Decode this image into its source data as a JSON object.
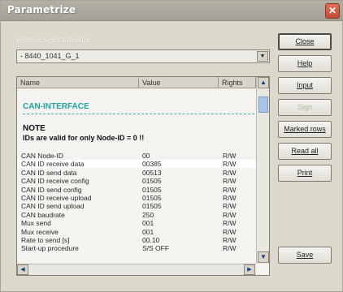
{
  "window": {
    "title": "Parametrize"
  },
  "device": {
    "label": "Please select device:",
    "selected": "- 8440_1041_G_1"
  },
  "table": {
    "columns": [
      "Name",
      "Value",
      "Rights"
    ],
    "section_title": "CAN-INTERFACE",
    "note_title": "NOTE",
    "note_text": "IDs are valid for only Node-ID = 0 !!",
    "rows": [
      {
        "name": "CAN Node-ID",
        "value": "00",
        "rights": "R/W"
      },
      {
        "name": "CAN ID receive data",
        "value": "00385",
        "rights": "R/W",
        "selected": true
      },
      {
        "name": "CAN ID send data",
        "value": "00513",
        "rights": "R/W"
      },
      {
        "name": "CAN ID receive config",
        "value": "01505",
        "rights": "R/W"
      },
      {
        "name": "CAN ID send config",
        "value": "01505",
        "rights": "R/W"
      },
      {
        "name": "CAN ID receive upload",
        "value": "01505",
        "rights": "R/W"
      },
      {
        "name": "CAN ID send upload",
        "value": "01505",
        "rights": "R/W"
      },
      {
        "name": "CAN baudrate",
        "value": "250",
        "rights": "R/W"
      },
      {
        "name": "Mux send",
        "value": "001",
        "rights": "R/W"
      },
      {
        "name": "Mux receive",
        "value": "001",
        "rights": "R/W"
      },
      {
        "name": "Rate to send [s]",
        "value": "00.10",
        "rights": "R/W"
      },
      {
        "name": "Start-up procedure",
        "value": "S/S OFF",
        "rights": "R/W"
      }
    ]
  },
  "buttons": {
    "close": "Close",
    "help": "Help",
    "input": "Input",
    "disabled": "Sign",
    "marked_rows": "Marked rows",
    "read_all": "Read all",
    "print": "Print",
    "save": "Save"
  }
}
